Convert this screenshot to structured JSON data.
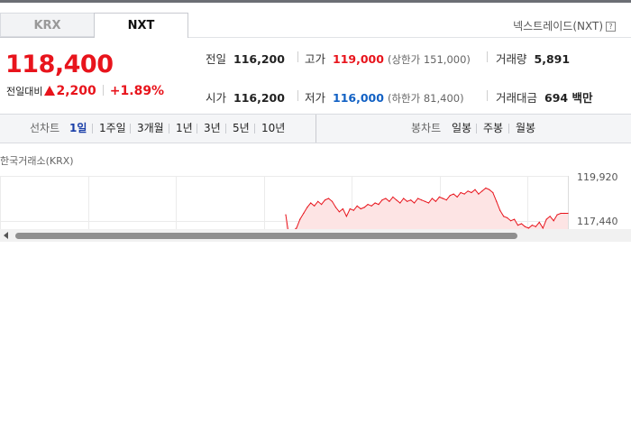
{
  "tabs": {
    "krx": "KRX",
    "nxt": "NXT"
  },
  "nxt_link": "넥스트레이드(NXT)",
  "help_glyph": "?",
  "price": "118,400",
  "change": {
    "label": "전일대비",
    "amount": "2,200",
    "percent": "+1.89%"
  },
  "info": {
    "prev_close": {
      "label": "전일",
      "value": "116,200"
    },
    "high": {
      "label": "고가",
      "value": "119,000",
      "sub": "(상한가 151,000)"
    },
    "volume": {
      "label": "거래량",
      "value": "5,891"
    },
    "open": {
      "label": "시가",
      "value": "116,200"
    },
    "low": {
      "label": "저가",
      "value": "116,000",
      "sub": "(하한가 81,400)"
    },
    "amount": {
      "label": "거래대금",
      "value": "694 백만"
    }
  },
  "period_bar": {
    "line_label": "선차트",
    "line_items": [
      "1일",
      "1주일",
      "3개월",
      "1년",
      "3년",
      "5년",
      "10년"
    ],
    "active_index": 0,
    "candle_label": "봉차트",
    "candle_items": [
      "일봉",
      "주봉",
      "월봉"
    ]
  },
  "market_label": "한국거래소(KRX)",
  "chart_data": {
    "type": "area",
    "y_ticks": [
      "119,920",
      "117,440"
    ],
    "ylim": [
      116300,
      120400
    ],
    "x": [
      0,
      1,
      2,
      3,
      4,
      5,
      6,
      7,
      8,
      9,
      10,
      11,
      12,
      13,
      14,
      15,
      16,
      17,
      18,
      19,
      20,
      21,
      22,
      23,
      24,
      25,
      26,
      27,
      28,
      29,
      30,
      31,
      32,
      33,
      34,
      35,
      36,
      37,
      38,
      39,
      40,
      41,
      42,
      43,
      44,
      45,
      46,
      47,
      48,
      49,
      50,
      51,
      52,
      53,
      54,
      55,
      56,
      57,
      58,
      59,
      60,
      61,
      62,
      63,
      64,
      65,
      66,
      67,
      68,
      69,
      70,
      71,
      72,
      73,
      74,
      75,
      76,
      77,
      78,
      79
    ],
    "values": [
      117900,
      116300,
      116800,
      117000,
      117600,
      118000,
      118400,
      118700,
      118500,
      118800,
      118600,
      118900,
      119000,
      118800,
      118400,
      118100,
      118300,
      117800,
      118300,
      118200,
      118500,
      118300,
      118400,
      118600,
      118500,
      118700,
      118600,
      118900,
      119000,
      118800,
      119100,
      118900,
      118700,
      119000,
      118800,
      118900,
      118700,
      119000,
      118900,
      118800,
      118700,
      119000,
      118800,
      119100,
      119000,
      118900,
      119200,
      119300,
      119100,
      119400,
      119300,
      119500,
      119400,
      119600,
      119300,
      119500,
      119700,
      119600,
      119400,
      118800,
      118200,
      117800,
      117700,
      117500,
      117600,
      117200,
      117300,
      117100,
      117000,
      117200,
      117100,
      117400,
      117000,
      117600,
      117800,
      117500,
      117900,
      118000,
      118000,
      118000
    ],
    "color": "#e8141c",
    "fill": "#fde4e4"
  },
  "colors": {
    "up": "#e8141c",
    "down": "#1261c4",
    "active": "#1a3fa8"
  }
}
